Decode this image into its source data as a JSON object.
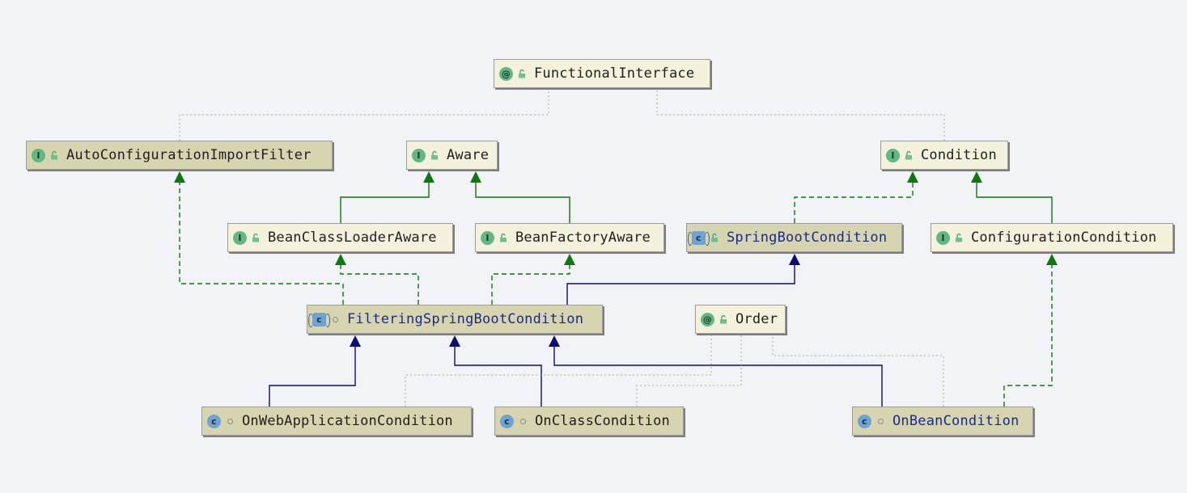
{
  "diagram": {
    "nodes": [
      {
        "id": "FunctionalInterface",
        "label": "FunctionalInterface",
        "kind": "annotation",
        "visibility": "unlocked-icon",
        "style": "light"
      },
      {
        "id": "AutoConfigurationImportFilter",
        "label": "AutoConfigurationImportFilter",
        "kind": "interface",
        "visibility": "unlocked-icon",
        "style": "dark"
      },
      {
        "id": "Aware",
        "label": "Aware",
        "kind": "interface",
        "visibility": "unlocked-icon",
        "style": "light"
      },
      {
        "id": "Condition",
        "label": "Condition",
        "kind": "interface",
        "visibility": "unlocked-icon",
        "style": "light"
      },
      {
        "id": "BeanClassLoaderAware",
        "label": "BeanClassLoaderAware",
        "kind": "interface",
        "visibility": "unlocked-icon",
        "style": "light"
      },
      {
        "id": "BeanFactoryAware",
        "label": "BeanFactoryAware",
        "kind": "interface",
        "visibility": "unlocked-icon",
        "style": "light"
      },
      {
        "id": "SpringBootCondition",
        "label": "SpringBootCondition",
        "kind": "abstract-class",
        "visibility": "unlocked-icon",
        "style": "dark",
        "text_color": "blue"
      },
      {
        "id": "ConfigurationCondition",
        "label": "ConfigurationCondition",
        "kind": "interface",
        "visibility": "unlocked-icon",
        "style": "light"
      },
      {
        "id": "FilteringSpringBootCondition",
        "label": "FilteringSpringBootCondition",
        "kind": "abstract-class",
        "visibility": "package-dot-icon",
        "style": "dark",
        "text_color": "blue"
      },
      {
        "id": "Order",
        "label": "Order",
        "kind": "annotation",
        "visibility": "unlocked-icon",
        "style": "light"
      },
      {
        "id": "OnWebApplicationCondition",
        "label": "OnWebApplicationCondition",
        "kind": "class",
        "visibility": "package-dot-icon",
        "style": "dark"
      },
      {
        "id": "OnClassCondition",
        "label": "OnClassCondition",
        "kind": "class",
        "visibility": "package-dot-icon",
        "style": "dark"
      },
      {
        "id": "OnBeanCondition",
        "label": "OnBeanCondition",
        "kind": "class",
        "visibility": "package-dot-icon",
        "style": "dark",
        "text_color": "blue"
      }
    ],
    "edges": [
      {
        "from": "AutoConfigurationImportFilter",
        "to": "FunctionalInterface",
        "type": "annotated"
      },
      {
        "from": "Condition",
        "to": "FunctionalInterface",
        "type": "annotated"
      },
      {
        "from": "BeanClassLoaderAware",
        "to": "Aware",
        "type": "extends"
      },
      {
        "from": "BeanFactoryAware",
        "to": "Aware",
        "type": "extends"
      },
      {
        "from": "SpringBootCondition",
        "to": "Condition",
        "type": "implements"
      },
      {
        "from": "ConfigurationCondition",
        "to": "Condition",
        "type": "extends"
      },
      {
        "from": "FilteringSpringBootCondition",
        "to": "AutoConfigurationImportFilter",
        "type": "implements"
      },
      {
        "from": "FilteringSpringBootCondition",
        "to": "BeanClassLoaderAware",
        "type": "implements"
      },
      {
        "from": "FilteringSpringBootCondition",
        "to": "BeanFactoryAware",
        "type": "implements"
      },
      {
        "from": "FilteringSpringBootCondition",
        "to": "SpringBootCondition",
        "type": "class-extends"
      },
      {
        "from": "OnWebApplicationCondition",
        "to": "FilteringSpringBootCondition",
        "type": "class-extends"
      },
      {
        "from": "OnClassCondition",
        "to": "FilteringSpringBootCondition",
        "type": "class-extends"
      },
      {
        "from": "OnBeanCondition",
        "to": "FilteringSpringBootCondition",
        "type": "class-extends"
      },
      {
        "from": "OnBeanCondition",
        "to": "ConfigurationCondition",
        "type": "implements"
      },
      {
        "from": "OnWebApplicationCondition",
        "to": "Order",
        "type": "annotated"
      },
      {
        "from": "OnClassCondition",
        "to": "Order",
        "type": "annotated"
      },
      {
        "from": "OnBeanCondition",
        "to": "Order",
        "type": "annotated"
      }
    ],
    "colors": {
      "background": "#f2f3f7",
      "node_light": "#f4f1dd",
      "node_dark": "#d7d5b0",
      "class_text_blue": "#1b2b8c",
      "interface_edge_green": "#0a7a0a",
      "class_edge_navy": "#0a0a82",
      "annotation_edge_gray": "#b8b8a8"
    }
  }
}
